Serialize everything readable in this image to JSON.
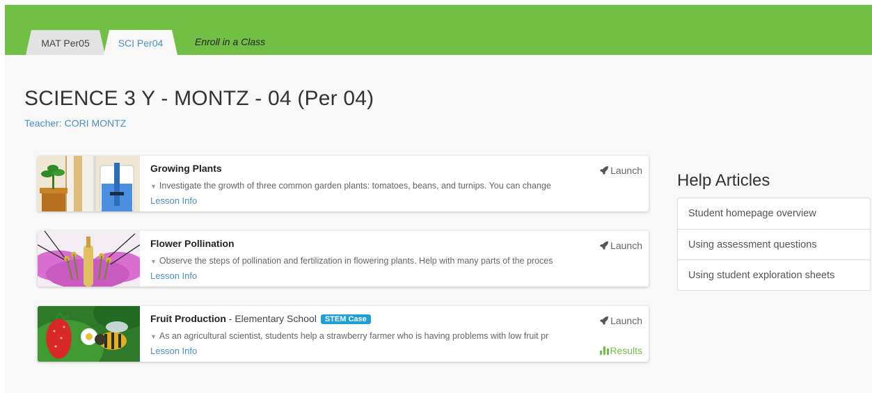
{
  "tabs": [
    {
      "label": "MAT Per05",
      "active": false
    },
    {
      "label": "SCI Per04",
      "active": true
    }
  ],
  "enroll_label": "Enroll in a Class",
  "class": {
    "title": "SCIENCE 3 Y - MONTZ - 04 (Per 04)",
    "teacher": "Teacher: CORI MONTZ"
  },
  "lessons": [
    {
      "name": "Growing Plants",
      "description": "Investigate the growth of three common garden plants: tomatoes, beans, and turnips. You can change",
      "info_label": "Lesson Info",
      "launch_label": "Launch"
    },
    {
      "name": "Flower Pollination",
      "description": "Observe the steps of pollination and fertilization in flowering plants. Help with many parts of the proces",
      "info_label": "Lesson Info",
      "launch_label": "Launch"
    },
    {
      "name": "Fruit Production",
      "level": " - Elementary School",
      "badge": "STEM Case",
      "description": "As an agricultural scientist, students help a strawberry farmer who is having problems with low fruit pr",
      "info_label": "Lesson Info",
      "launch_label": "Launch",
      "results_label": "Results"
    }
  ],
  "help": {
    "title": "Help Articles",
    "items": [
      "Student homepage overview",
      "Using assessment questions",
      "Using student exploration sheets"
    ]
  },
  "colors": {
    "brand_green": "#71bf44",
    "link_blue": "#4a90c2",
    "badge_blue": "#1e9fd8"
  },
  "icons": {
    "launch": "rocket-icon",
    "results": "bar-chart-icon",
    "expand": "caret-down-icon"
  }
}
